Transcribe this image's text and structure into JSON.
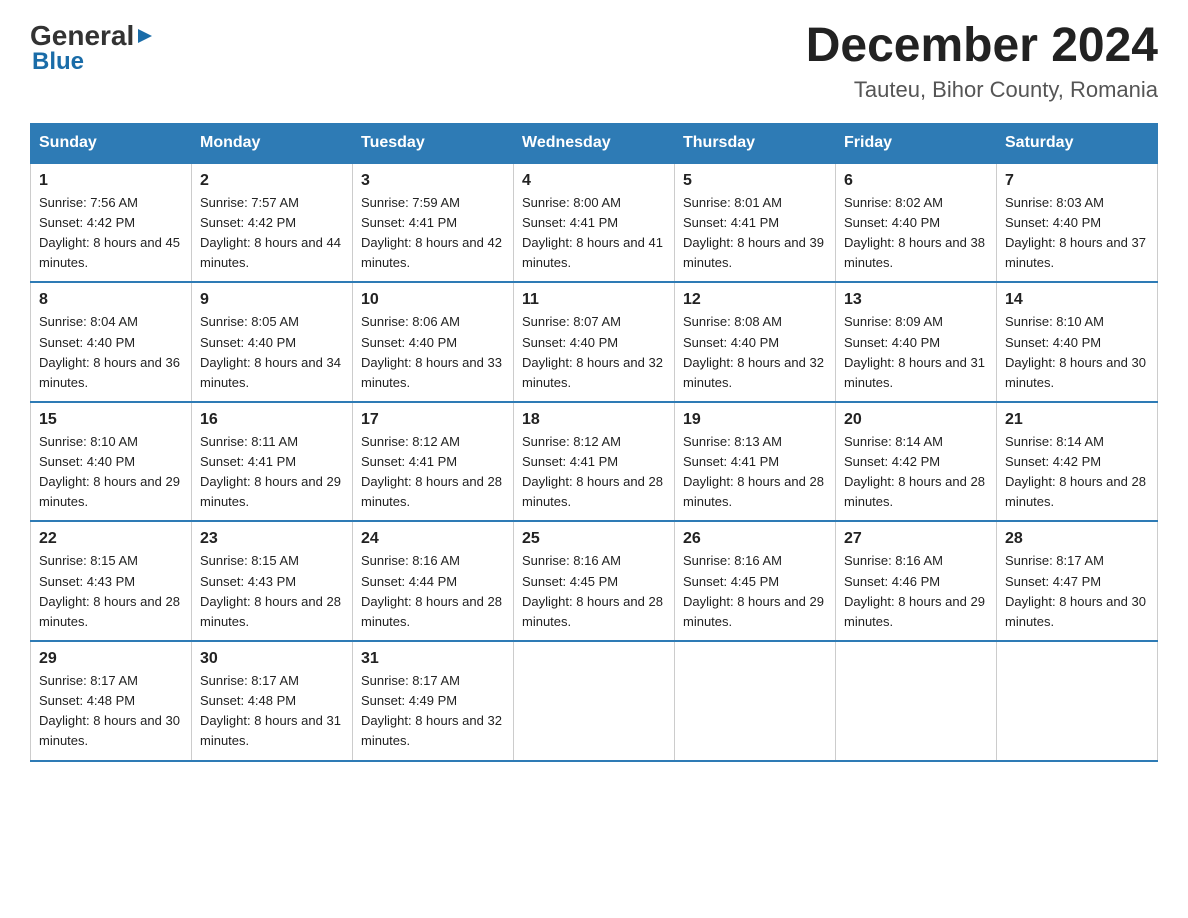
{
  "header": {
    "logo_general": "General",
    "logo_blue": "Blue",
    "main_title": "December 2024",
    "subtitle": "Tauteu, Bihor County, Romania"
  },
  "weekdays": [
    "Sunday",
    "Monday",
    "Tuesday",
    "Wednesday",
    "Thursday",
    "Friday",
    "Saturday"
  ],
  "weeks": [
    [
      {
        "day": "1",
        "sunrise": "7:56 AM",
        "sunset": "4:42 PM",
        "daylight": "8 hours and 45 minutes."
      },
      {
        "day": "2",
        "sunrise": "7:57 AM",
        "sunset": "4:42 PM",
        "daylight": "8 hours and 44 minutes."
      },
      {
        "day": "3",
        "sunrise": "7:59 AM",
        "sunset": "4:41 PM",
        "daylight": "8 hours and 42 minutes."
      },
      {
        "day": "4",
        "sunrise": "8:00 AM",
        "sunset": "4:41 PM",
        "daylight": "8 hours and 41 minutes."
      },
      {
        "day": "5",
        "sunrise": "8:01 AM",
        "sunset": "4:41 PM",
        "daylight": "8 hours and 39 minutes."
      },
      {
        "day": "6",
        "sunrise": "8:02 AM",
        "sunset": "4:40 PM",
        "daylight": "8 hours and 38 minutes."
      },
      {
        "day": "7",
        "sunrise": "8:03 AM",
        "sunset": "4:40 PM",
        "daylight": "8 hours and 37 minutes."
      }
    ],
    [
      {
        "day": "8",
        "sunrise": "8:04 AM",
        "sunset": "4:40 PM",
        "daylight": "8 hours and 36 minutes."
      },
      {
        "day": "9",
        "sunrise": "8:05 AM",
        "sunset": "4:40 PM",
        "daylight": "8 hours and 34 minutes."
      },
      {
        "day": "10",
        "sunrise": "8:06 AM",
        "sunset": "4:40 PM",
        "daylight": "8 hours and 33 minutes."
      },
      {
        "day": "11",
        "sunrise": "8:07 AM",
        "sunset": "4:40 PM",
        "daylight": "8 hours and 32 minutes."
      },
      {
        "day": "12",
        "sunrise": "8:08 AM",
        "sunset": "4:40 PM",
        "daylight": "8 hours and 32 minutes."
      },
      {
        "day": "13",
        "sunrise": "8:09 AM",
        "sunset": "4:40 PM",
        "daylight": "8 hours and 31 minutes."
      },
      {
        "day": "14",
        "sunrise": "8:10 AM",
        "sunset": "4:40 PM",
        "daylight": "8 hours and 30 minutes."
      }
    ],
    [
      {
        "day": "15",
        "sunrise": "8:10 AM",
        "sunset": "4:40 PM",
        "daylight": "8 hours and 29 minutes."
      },
      {
        "day": "16",
        "sunrise": "8:11 AM",
        "sunset": "4:41 PM",
        "daylight": "8 hours and 29 minutes."
      },
      {
        "day": "17",
        "sunrise": "8:12 AM",
        "sunset": "4:41 PM",
        "daylight": "8 hours and 28 minutes."
      },
      {
        "day": "18",
        "sunrise": "8:12 AM",
        "sunset": "4:41 PM",
        "daylight": "8 hours and 28 minutes."
      },
      {
        "day": "19",
        "sunrise": "8:13 AM",
        "sunset": "4:41 PM",
        "daylight": "8 hours and 28 minutes."
      },
      {
        "day": "20",
        "sunrise": "8:14 AM",
        "sunset": "4:42 PM",
        "daylight": "8 hours and 28 minutes."
      },
      {
        "day": "21",
        "sunrise": "8:14 AM",
        "sunset": "4:42 PM",
        "daylight": "8 hours and 28 minutes."
      }
    ],
    [
      {
        "day": "22",
        "sunrise": "8:15 AM",
        "sunset": "4:43 PM",
        "daylight": "8 hours and 28 minutes."
      },
      {
        "day": "23",
        "sunrise": "8:15 AM",
        "sunset": "4:43 PM",
        "daylight": "8 hours and 28 minutes."
      },
      {
        "day": "24",
        "sunrise": "8:16 AM",
        "sunset": "4:44 PM",
        "daylight": "8 hours and 28 minutes."
      },
      {
        "day": "25",
        "sunrise": "8:16 AM",
        "sunset": "4:45 PM",
        "daylight": "8 hours and 28 minutes."
      },
      {
        "day": "26",
        "sunrise": "8:16 AM",
        "sunset": "4:45 PM",
        "daylight": "8 hours and 29 minutes."
      },
      {
        "day": "27",
        "sunrise": "8:16 AM",
        "sunset": "4:46 PM",
        "daylight": "8 hours and 29 minutes."
      },
      {
        "day": "28",
        "sunrise": "8:17 AM",
        "sunset": "4:47 PM",
        "daylight": "8 hours and 30 minutes."
      }
    ],
    [
      {
        "day": "29",
        "sunrise": "8:17 AM",
        "sunset": "4:48 PM",
        "daylight": "8 hours and 30 minutes."
      },
      {
        "day": "30",
        "sunrise": "8:17 AM",
        "sunset": "4:48 PM",
        "daylight": "8 hours and 31 minutes."
      },
      {
        "day": "31",
        "sunrise": "8:17 AM",
        "sunset": "4:49 PM",
        "daylight": "8 hours and 32 minutes."
      },
      null,
      null,
      null,
      null
    ]
  ]
}
